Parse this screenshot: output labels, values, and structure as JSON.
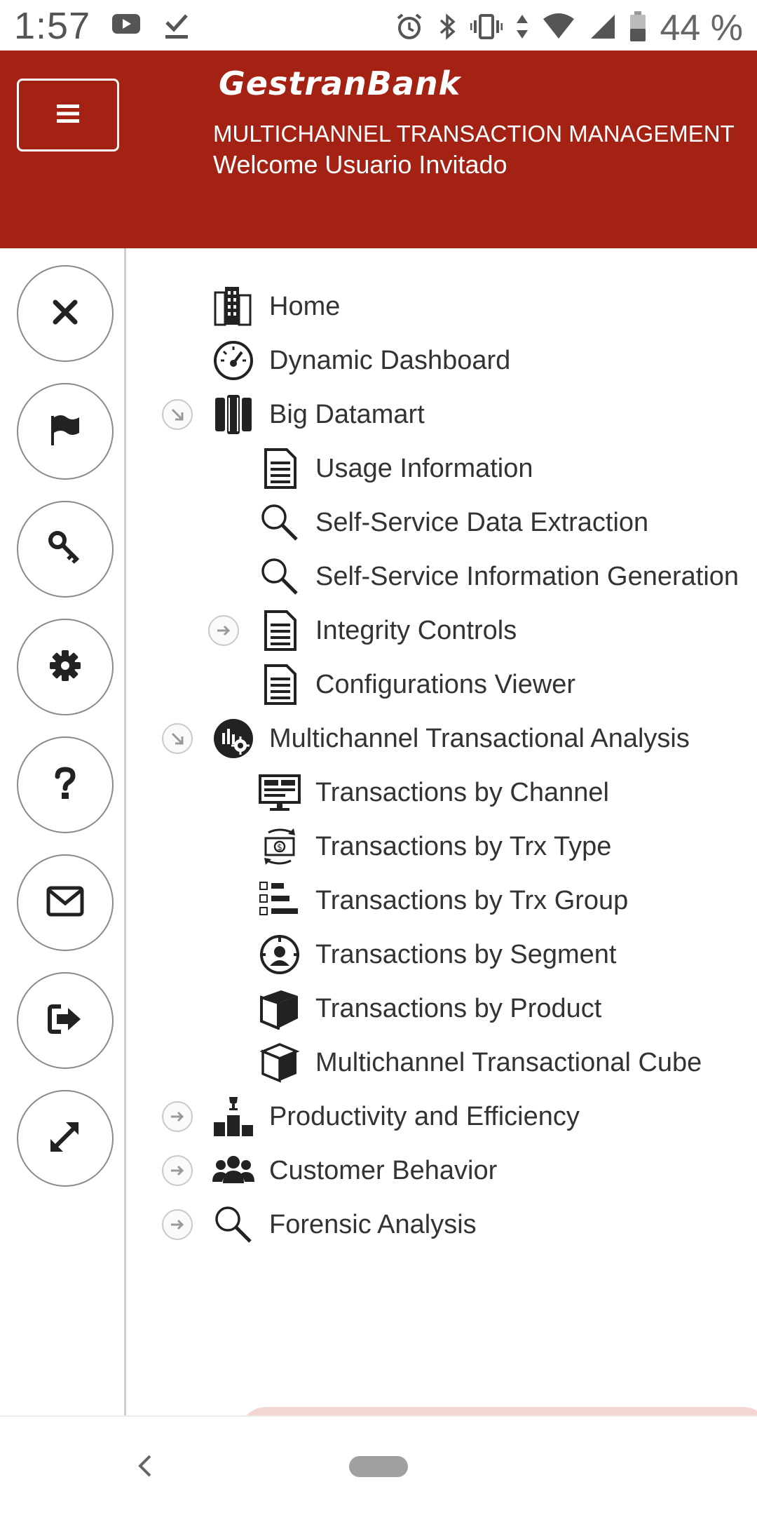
{
  "status_bar": {
    "time": "1:57",
    "battery_text": "44 %",
    "left_icons": [
      "youtube-icon",
      "download-done-icon"
    ],
    "right_icons": [
      "alarm-icon",
      "bluetooth-icon",
      "vibrate-icon",
      "data-arrows-icon",
      "wifi-icon",
      "signal-icon",
      "battery-icon"
    ]
  },
  "header": {
    "brand": "GestranBank",
    "subtitle": "MULTICHANNEL TRANSACTION MANAGEMENT",
    "welcome": "Welcome Usuario Invitado",
    "menu_icon": "hamburger-icon",
    "background_color": "#a42214"
  },
  "side_rail": {
    "buttons": [
      {
        "name": "close",
        "icon": "close-icon"
      },
      {
        "name": "flag",
        "icon": "flag-icon"
      },
      {
        "name": "key",
        "icon": "key-icon"
      },
      {
        "name": "settings",
        "icon": "gear-icon"
      },
      {
        "name": "help",
        "icon": "question-icon"
      },
      {
        "name": "mail",
        "icon": "envelope-icon"
      },
      {
        "name": "logout",
        "icon": "sign-out-icon"
      },
      {
        "name": "expand",
        "icon": "expand-icon"
      }
    ]
  },
  "tree": {
    "items": [
      {
        "label": "Home",
        "icon": "buildings-icon",
        "level": 0,
        "expander": "none"
      },
      {
        "label": "Dynamic Dashboard",
        "icon": "speedometer-icon",
        "level": 0,
        "expander": "none"
      },
      {
        "label": "Big Datamart",
        "icon": "server-rack-icon",
        "level": 0,
        "expander": "expanded"
      },
      {
        "label": "Usage Information",
        "icon": "document-icon",
        "level": 1,
        "expander": "none"
      },
      {
        "label": "Self-Service Data Extraction",
        "icon": "magnifier-icon",
        "level": 1,
        "expander": "none"
      },
      {
        "label": "Self-Service Information Generation",
        "icon": "magnifier-icon",
        "level": 1,
        "expander": "none"
      },
      {
        "label": "Integrity Controls",
        "icon": "document-icon",
        "level": 1,
        "expander": "collapsed"
      },
      {
        "label": "Configurations Viewer",
        "icon": "document-icon",
        "level": 1,
        "expander": "none"
      },
      {
        "label": "Multichannel Transactional Analysis",
        "icon": "analytics-gear-icon",
        "level": 0,
        "expander": "expanded"
      },
      {
        "label": "Transactions by Channel",
        "icon": "monitor-icon",
        "level": 1,
        "expander": "none"
      },
      {
        "label": "Transactions by Trx Type",
        "icon": "money-exchange-icon",
        "level": 1,
        "expander": "none"
      },
      {
        "label": "Transactions by Trx Group",
        "icon": "grouped-list-icon",
        "level": 1,
        "expander": "none"
      },
      {
        "label": "Transactions by Segment",
        "icon": "user-target-icon",
        "level": 1,
        "expander": "none"
      },
      {
        "label": "Transactions by Product",
        "icon": "box-icon",
        "level": 1,
        "expander": "none"
      },
      {
        "label": "Multichannel Transactional Cube",
        "icon": "cube-icon",
        "level": 1,
        "expander": "none"
      },
      {
        "label": "Productivity and Efficiency",
        "icon": "podium-trophy-icon",
        "level": 0,
        "expander": "collapsed"
      },
      {
        "label": "Customer Behavior",
        "icon": "users-icon",
        "level": 0,
        "expander": "collapsed"
      },
      {
        "label": "Forensic Analysis",
        "icon": "magnifier-icon",
        "level": 0,
        "expander": "collapsed"
      }
    ]
  },
  "nav_bar": {
    "back_icon": "back-chevron-icon",
    "home_icon": "home-pill-icon"
  }
}
